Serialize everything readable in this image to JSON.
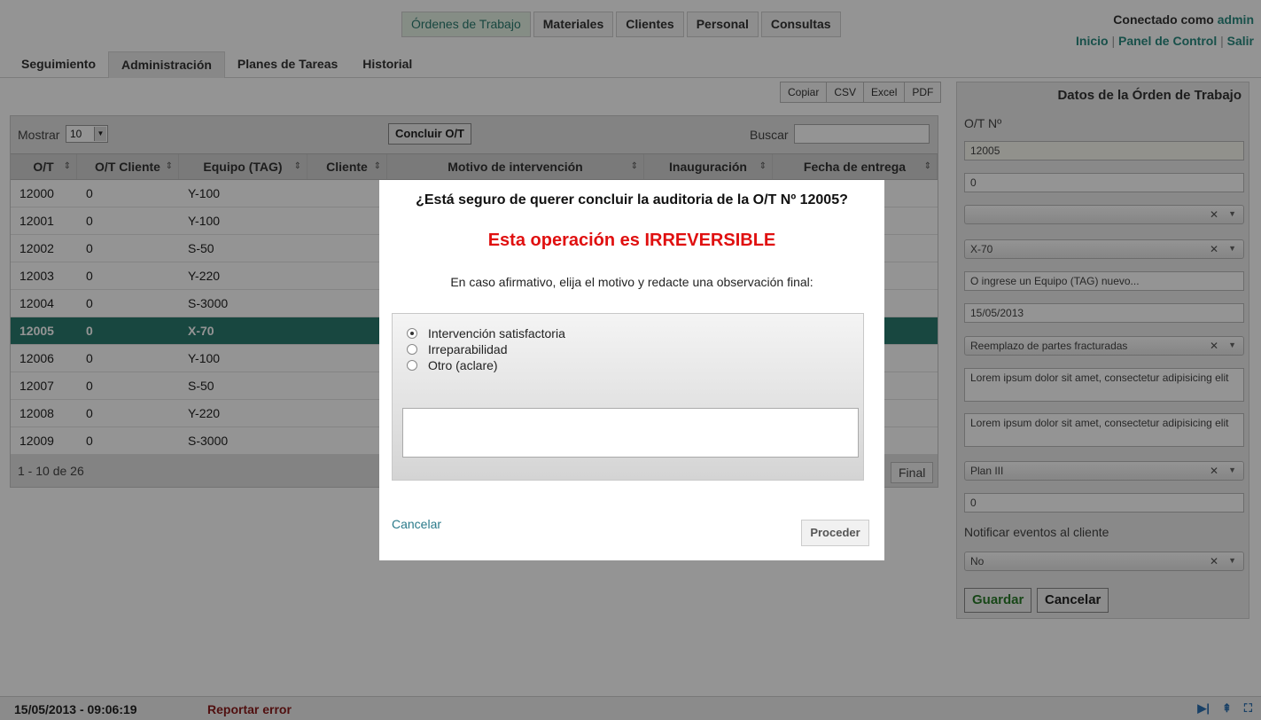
{
  "header": {
    "main_nav": [
      "Órdenes de Trabajo",
      "Materiales",
      "Clientes",
      "Personal",
      "Consultas"
    ],
    "user": {
      "connected_label": "Conectado como",
      "username": "admin"
    },
    "links": [
      "Inicio",
      "Panel de Control",
      "Salir"
    ],
    "subtabs": [
      "Seguimiento",
      "Administración",
      "Planes de Tareas",
      "Historial"
    ]
  },
  "toolbar": {
    "export": [
      "Copiar",
      "CSV",
      "Excel",
      "PDF"
    ]
  },
  "grid": {
    "show_label": "Mostrar",
    "show_value": "10",
    "conclude_label": "Concluir O/T",
    "search_label": "Buscar",
    "columns": [
      "O/T",
      "O/T Cliente",
      "Equipo (TAG)",
      "Cliente",
      "Motivo de intervención",
      "Inauguración",
      "Fecha de entrega"
    ],
    "rows": [
      [
        "12000",
        "0",
        "Y-100"
      ],
      [
        "12001",
        "0",
        "Y-100"
      ],
      [
        "12002",
        "0",
        "S-50"
      ],
      [
        "12003",
        "0",
        "Y-220"
      ],
      [
        "12004",
        "0",
        "S-3000"
      ],
      [
        "12005",
        "0",
        "X-70"
      ],
      [
        "12006",
        "0",
        "Y-100"
      ],
      [
        "12007",
        "0",
        "S-50"
      ],
      [
        "12008",
        "0",
        "Y-220"
      ],
      [
        "12009",
        "0",
        "S-3000"
      ]
    ],
    "selected_row": 5,
    "range_text": "1 - 10 de 26",
    "final_label": "Final"
  },
  "side_panel": {
    "title": "Datos de la Órden de Trabajo",
    "ot_label": "O/T Nº",
    "ot_value": "12005",
    "client_ot_value": "0",
    "select1_value": "",
    "equipo_value": "X-70",
    "equipo_placeholder": "O ingrese un Equipo (TAG) nuevo...",
    "date_value": "15/05/2013",
    "motivo_value": "Reemplazo de partes fracturadas",
    "text1": "Lorem ipsum dolor sit amet, consectetur adipisicing elit",
    "text2": "Lorem ipsum dolor sit amet, consectetur adipisicing elit",
    "plan_value": "Plan III",
    "num_value": "0",
    "notify_label": "Notificar eventos al cliente",
    "notify_value": "No",
    "save_label": "Guardar",
    "cancel_label": "Cancelar"
  },
  "status": {
    "datetime": "15/05/2013 - 09:06:19",
    "report_label": "Reportar error"
  },
  "modal": {
    "question": "¿Está seguro de querer concluir la auditoria de la O/T Nº 12005?",
    "warning": "Esta operación es IRREVERSIBLE",
    "instruction": "En caso afirmativo, elija el motivo y redacte una observación final:",
    "options": [
      "Intervención satisfactoria",
      "Irreparabilidad",
      "Otro (aclare)"
    ],
    "selected_option": 0,
    "cancel_label": "Cancelar",
    "proceed_label": "Proceder"
  },
  "colors": {
    "accent": "#2a7a6f",
    "warning": "#e01010"
  }
}
